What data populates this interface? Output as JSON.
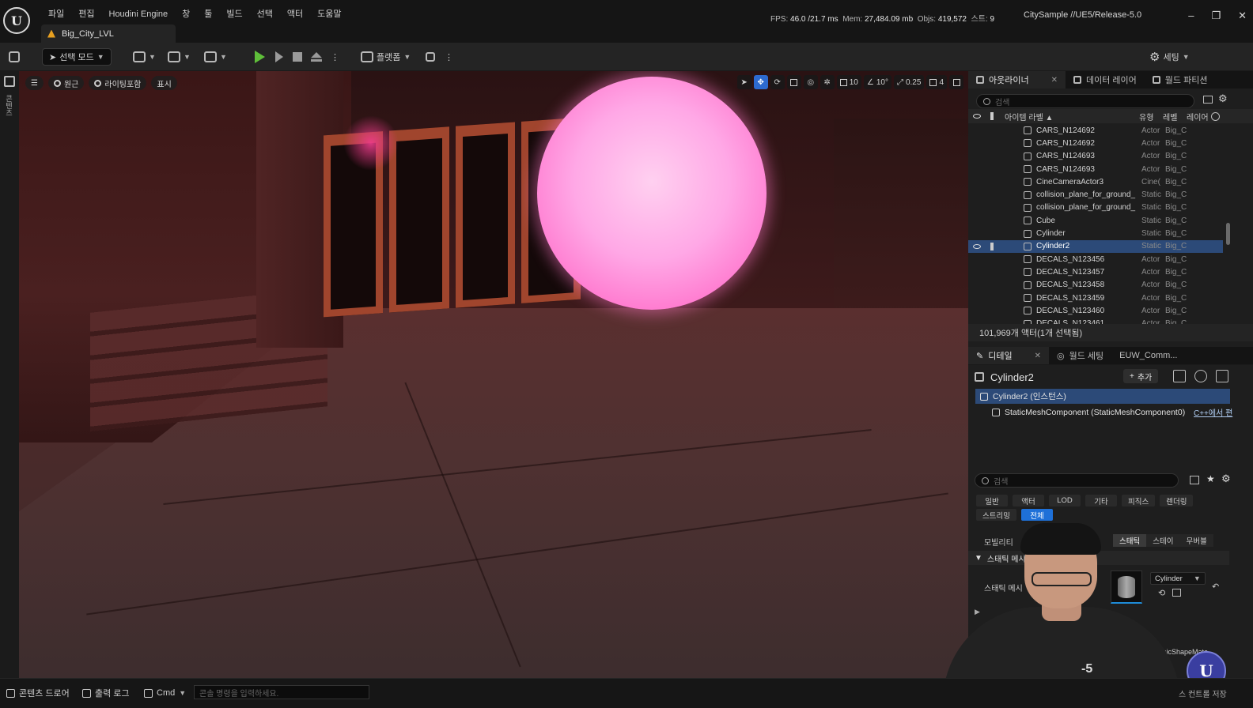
{
  "app": {
    "menu": [
      "파일",
      "편집",
      "Houdini Engine",
      "창",
      "툴",
      "빌드",
      "선택",
      "액터",
      "도움말"
    ],
    "level_tab": "Big_City_LVL",
    "stats": {
      "fps_label": "FPS:",
      "fps": "46.0",
      "ms": "/21.7 ms",
      "mem_label": "Mem:",
      "mem": "27,484.09 mb",
      "objs_label": "Objs:",
      "objs": "419,572",
      "stream_label": "스트:",
      "stream": "9"
    },
    "project": "CitySample //UE5/Release-5.0"
  },
  "toolbar": {
    "mode": "선택 모드",
    "platform": "플랫폼",
    "settings": "세팅"
  },
  "left_strip": {
    "label": "콘텐츠"
  },
  "viewport": {
    "chips": [
      "원근",
      "라이팅포함",
      "표시"
    ],
    "grid": "10",
    "angle": "10°",
    "scale": "0.25",
    "camera_speed": "4"
  },
  "outliner": {
    "tabs": [
      "아웃라이너",
      "데이터 레이어",
      "월드 파티션"
    ],
    "search_placeholder": "검색",
    "header": {
      "label": "아이템 라벨 ▲",
      "type": "유형",
      "level": "레벨",
      "layer": "레이어"
    },
    "rows": [
      {
        "name": "CARS_N124692",
        "type": "Actor",
        "level": "Big_C",
        "selected": false
      },
      {
        "name": "CARS_N124692",
        "type": "Actor",
        "level": "Big_C",
        "selected": false
      },
      {
        "name": "CARS_N124693",
        "type": "Actor",
        "level": "Big_C",
        "selected": false
      },
      {
        "name": "CARS_N124693",
        "type": "Actor",
        "level": "Big_C",
        "selected": false
      },
      {
        "name": "CineCameraActor3",
        "type": "Cine(",
        "level": "Big_C",
        "selected": false
      },
      {
        "name": "collision_plane_for_ground_",
        "type": "Static",
        "level": "Big_C",
        "selected": false
      },
      {
        "name": "collision_plane_for_ground_",
        "type": "Static",
        "level": "Big_C",
        "selected": false
      },
      {
        "name": "Cube",
        "type": "Static",
        "level": "Big_C",
        "selected": false
      },
      {
        "name": "Cylinder",
        "type": "Static",
        "level": "Big_C",
        "selected": false
      },
      {
        "name": "Cylinder2",
        "type": "Static",
        "level": "Big_C",
        "selected": true
      },
      {
        "name": "DECALS_N123456",
        "type": "Actor",
        "level": "Big_C",
        "selected": false
      },
      {
        "name": "DECALS_N123457",
        "type": "Actor",
        "level": "Big_C",
        "selected": false
      },
      {
        "name": "DECALS_N123458",
        "type": "Actor",
        "level": "Big_C",
        "selected": false
      },
      {
        "name": "DECALS_N123459",
        "type": "Actor",
        "level": "Big_C",
        "selected": false
      },
      {
        "name": "DECALS_N123460",
        "type": "Actor",
        "level": "Big_C",
        "selected": false
      },
      {
        "name": "DECALS_N123461",
        "type": "Actor",
        "level": "Big_C",
        "selected": false
      }
    ],
    "footer": "101,969개 액터(1개 선택됨)"
  },
  "details": {
    "tabs": [
      "디테일",
      "월드 세팅",
      "EUW_Comm..."
    ],
    "actor_name": "Cylinder2",
    "add_label": "추가",
    "instance_row": "Cylinder2 (인스턴스)",
    "component_row": "StaticMeshComponent (StaticMeshComponent0)",
    "component_link": "C++에서 편",
    "search_placeholder": "검색",
    "filters_row1": [
      "일반",
      "액터",
      "LOD",
      "기타",
      "피직스",
      "렌더링"
    ],
    "filters_row2": [
      "스트리밍",
      "전체"
    ],
    "mobility_label": "모빌리티",
    "mobility_options": [
      "스태틱",
      "스테이",
      "무버블"
    ],
    "section_static_mesh": "스태틱 메시",
    "static_mesh_label": "스태틱 메시",
    "static_mesh_value": "Cylinder",
    "material_value": "BasicShapeMate"
  },
  "statusbar": {
    "content_drawer": "콘텐츠 드로어",
    "output_log": "출력 로그",
    "cmd": "Cmd",
    "cmd_placeholder": "콘솔 명령을 입력하세요.",
    "right_text": "스 컨트롤 저장"
  }
}
